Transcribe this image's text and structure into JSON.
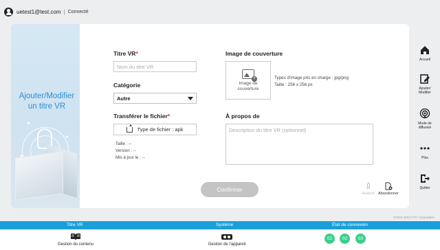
{
  "user": {
    "email": "uetest1@test.com",
    "separator": "|",
    "status": "Connecté"
  },
  "hero": {
    "title": "Ajouter/Modifier un titre VR"
  },
  "form": {
    "title_label": "Titre VR",
    "title_required": "*",
    "title_placeholder": "Nom du titre VR",
    "category_label": "Catégorie",
    "category_value": "Autre",
    "upload_label": "Transférer le fichier",
    "upload_required": "*",
    "upload_button": "Type de fichier : apk",
    "size_label": "Taille : --",
    "version_label": "Version : --",
    "updated_label": "Mis à jour le : --",
    "cover_label": "Image de couverture",
    "cover_box_label": "Image de couverture",
    "cover_hint_1": "Types d'image pris en charge : jpg/png",
    "cover_hint_2": "Taille : 256 x 256 px",
    "about_label": "À propos de",
    "about_placeholder": "Description du titre VR (optionnel)",
    "confirm_label": "Confirmer",
    "submit_label": "Avancé",
    "abandon_label": "Abandonner"
  },
  "sidebar": {
    "items": [
      {
        "label": "Accueil",
        "icon": "home-icon"
      },
      {
        "label": "Ajouter/ Modifier",
        "icon": "edit-icon"
      },
      {
        "label": "Mode de diffusion",
        "icon": "broadcast-icon"
      },
      {
        "label": "Plus",
        "icon": "more-icon"
      },
      {
        "label": "Quitter",
        "icon": "exit-icon"
      }
    ]
  },
  "footer": {
    "copyright": "©2022-2023 HTC Corporation",
    "bar_labels": [
      "Titre VR",
      "Système",
      "État de connexion"
    ],
    "content_label": "Gestion du contenu",
    "device_label": "Gestion de l'appareil",
    "connection_dots": [
      "01",
      "02",
      "03"
    ],
    "dot_color": "#3ccf8c",
    "bar_color": "#1b9fd9",
    "accent_color": "#2a8fd2"
  }
}
